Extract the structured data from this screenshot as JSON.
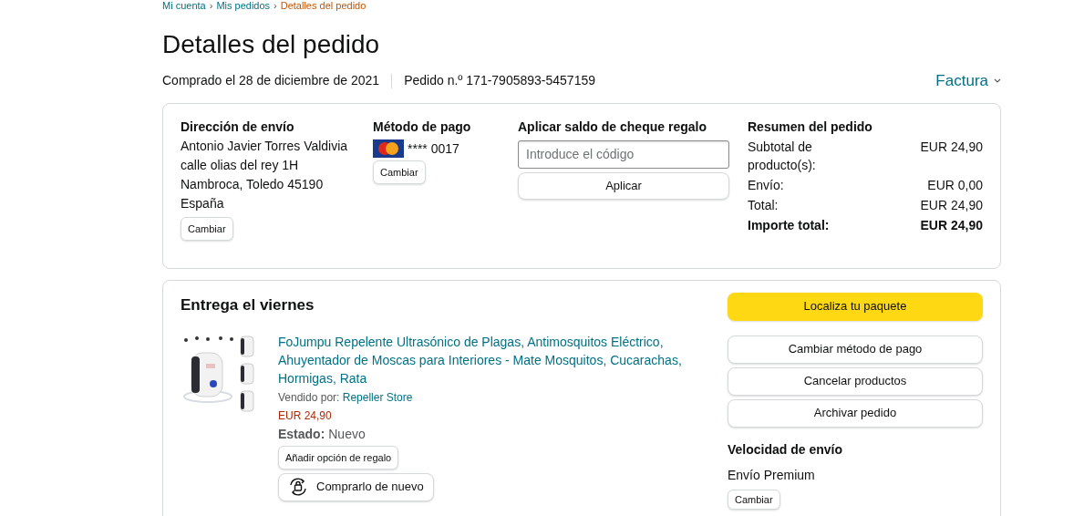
{
  "breadcrumb": {
    "separator": "›",
    "items": [
      {
        "label": "Mi cuenta",
        "selected": false
      },
      {
        "label": "Mis pedidos",
        "selected": false
      },
      {
        "label": "Detalles del pedido",
        "selected": true
      }
    ]
  },
  "title": "Detalles del pedido",
  "purchased": "Comprado el 28 de diciembre de 2021",
  "order_number": "Pedido n.º 171-7905893-5457159",
  "invoice": "Factura",
  "summary_box": {
    "shipping_address": {
      "heading": "Dirección de envío",
      "lines": [
        "Antonio Javier Torres Valdivia",
        "calle olias del rey 1H",
        "Nambroca, Toledo 45190",
        "España"
      ],
      "button": "Cambiar"
    },
    "payment": {
      "heading": "Método de pago",
      "card": "**** 0017",
      "button": "Cambiar"
    },
    "gift_card": {
      "heading": "Aplicar saldo de cheque regalo",
      "placeholder": "Introduce el código",
      "button": "Aplicar"
    },
    "order_summary": {
      "heading": "Resumen del pedido",
      "rows": [
        {
          "label": "Subtotal de producto(s):",
          "value": "EUR 24,90",
          "bold": false
        },
        {
          "label": "Envío:",
          "value": "EUR 0,00",
          "bold": false
        },
        {
          "label": "Total:",
          "value": "EUR 24,90",
          "bold": false
        },
        {
          "label": "Importe total:",
          "value": "EUR 24,90",
          "bold": true
        }
      ]
    }
  },
  "delivery": {
    "heading": "Entrega el viernes",
    "product": {
      "kind": "picture",
      "title": "FoJumpu Repelente Ultrasónico de Plagas, Antimosquitos Eléctrico, Ahuyentador de Moscas para Interiores - Mate Mosquitos, Cucarachas, Hormigas, Rata",
      "sold_by_label": "Vendido por:",
      "seller": "Repeller Store",
      "price": "EUR 24,90",
      "condition_label": "Estado:",
      "condition": "Nuevo",
      "gift_button": "Añadir opción de regalo",
      "buy_again_button": "Comprarlo de nuevo"
    },
    "actions": [
      {
        "label": "Localiza tu paquete",
        "primary": true
      },
      {
        "label": "Cambiar método de pago",
        "primary": false
      },
      {
        "label": "Cancelar productos",
        "primary": false
      },
      {
        "label": "Archivar pedido",
        "primary": false
      }
    ],
    "shipping_speed": {
      "heading": "Velocidad de envío",
      "value": "Envío Premium",
      "button": "Cambiar"
    }
  }
}
